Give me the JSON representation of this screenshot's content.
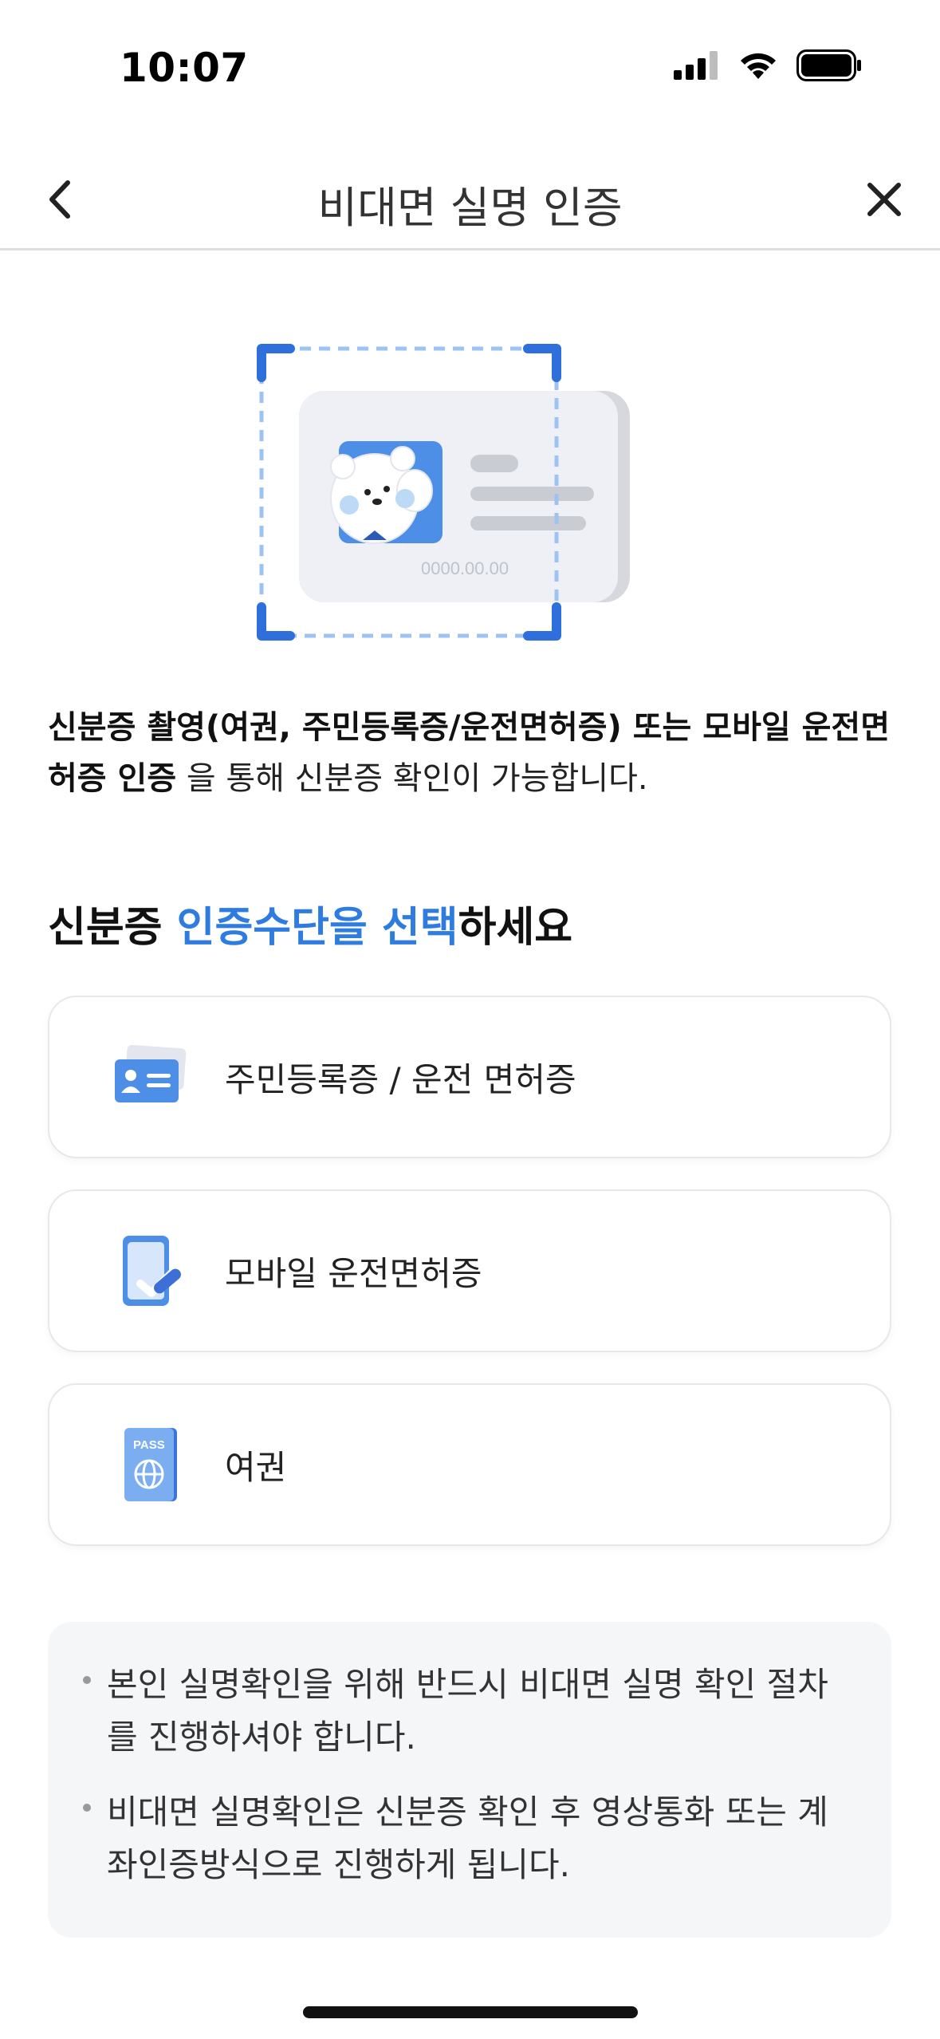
{
  "status": {
    "time": "10:07"
  },
  "header": {
    "title": "비대면 실명 인증"
  },
  "hero": {
    "card_number": "0000.00.00"
  },
  "intro": {
    "bold_part": "신분증 촬영(여권, 주민등록증/운전면허증) 또는 모바일 운전면허증 인증",
    "rest": " 을 통해 신분증 확인이 가능합니다."
  },
  "section": {
    "title_prefix": "신분증 ",
    "title_accent": "인증수단을 선택",
    "title_suffix": "하세요"
  },
  "options": [
    {
      "label": "주민등록증 / 운전 면허증",
      "icon": "id-card-icon"
    },
    {
      "label": "모바일 운전면허증",
      "icon": "mobile-license-icon"
    },
    {
      "label": "여권",
      "icon": "passport-icon",
      "icon_text": "PASS"
    }
  ],
  "notices": [
    "본인 실명확인을 위해 반드시 비대면 실명 확인 절차를 진행하셔야 합니다.",
    "비대면 실명확인은 신분증 확인 후 영상통화 또는 계좌인증방식으로 진행하게 됩니다."
  ],
  "colors": {
    "accent": "#2f7ce0",
    "icon_blue": "#4d8ee6"
  }
}
